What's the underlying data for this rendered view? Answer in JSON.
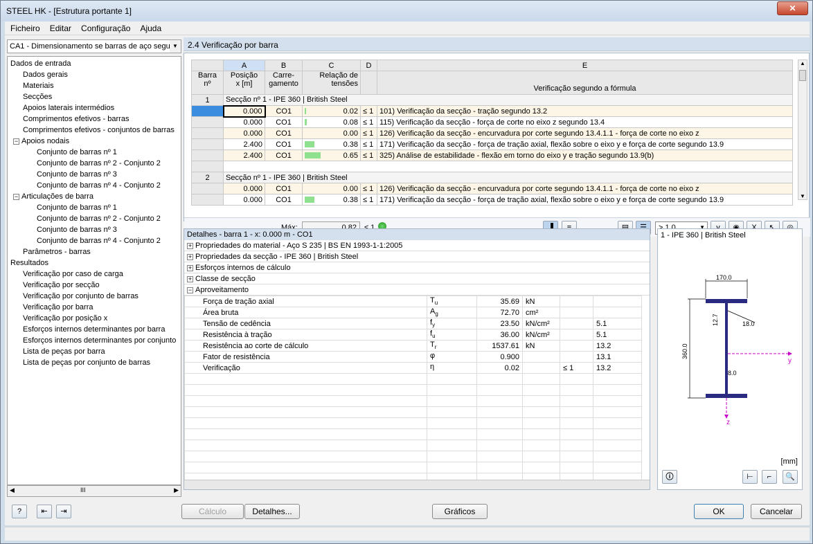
{
  "window": {
    "title": "STEEL HK - [Estrutura portante 1]",
    "close": "✕"
  },
  "menu": [
    "Ficheiro",
    "Editar",
    "Configuração",
    "Ajuda"
  ],
  "case_combo": "CA1 - Dimensionamento se barras de aço segui",
  "tree": {
    "input_root": "Dados de entrada",
    "input_items": [
      "Dados gerais",
      "Materiais",
      "Secções",
      "Apoios laterais intermédios",
      "Comprimentos efetivos - barras",
      "Comprimentos efetivos - conjuntos de barras"
    ],
    "nodal": "Apoios nodais",
    "nodal_items": [
      "Conjunto de barras nº 1",
      "Conjunto de barras nº 2 - Conjunto 2",
      "Conjunto de barras nº 3",
      "Conjunto de barras nº 4 - Conjunto 2"
    ],
    "hinges": "Articulações de barra",
    "hinge_items": [
      "Conjunto de barras nº 1",
      "Conjunto de barras nº 2 - Conjunto 2",
      "Conjunto de barras nº 3",
      "Conjunto de barras nº 4 - Conjunto 2"
    ],
    "params": "Parâmetros - barras",
    "results_root": "Resultados",
    "results_items": [
      "Verificação por caso de carga",
      "Verificação por secção",
      "Verificação por conjunto de barras",
      "Verificação por barra",
      "Verificação por posição x",
      "Esforços internos determinantes por barra",
      "Esforços internos determinantes por conjunto",
      "Lista de peças por barra",
      "Lista de peças por conjunto de barras"
    ],
    "scroll": "III"
  },
  "panel_title": "2.4 Verificação por barra",
  "grid": {
    "cols": [
      "A",
      "B",
      "C",
      "D",
      "E"
    ],
    "h_barra": "Barra",
    "h_no": "nº",
    "h_pos1": "Posição",
    "h_pos2": "x [m]",
    "h_carr1": "Carre-",
    "h_carr2": "gamento",
    "h_rel1": "Relação de",
    "h_rel2": "tensões",
    "h_verif": "Verificação segundo a fórmula",
    "groups": [
      {
        "no": "1",
        "section": "Secção nº 1 - IPE 360 | British Steel",
        "rows": [
          {
            "x": "0.000",
            "lc": "CO1",
            "ratio": "0.02",
            "r": 0.02,
            "le": "≤ 1",
            "desc": "101) Verificação da secção - tração segundo 13.2"
          },
          {
            "x": "0.000",
            "lc": "CO1",
            "ratio": "0.08",
            "r": 0.08,
            "le": "≤ 1",
            "desc": "115) Verificação da secção - força de corte no eixo z segundo 13.4"
          },
          {
            "x": "0.000",
            "lc": "CO1",
            "ratio": "0.00",
            "r": 0.0,
            "le": "≤ 1",
            "desc": "126) Verificação da secção - encurvadura por corte segundo 13.4.1.1 - força de corte no eixo z"
          },
          {
            "x": "2.400",
            "lc": "CO1",
            "ratio": "0.38",
            "r": 0.38,
            "le": "≤ 1",
            "desc": "171) Verificação da secção - força de tração axial, flexão sobre o eixo y e força de corte segundo 13.9"
          },
          {
            "x": "2.400",
            "lc": "CO1",
            "ratio": "0.65",
            "r": 0.65,
            "le": "≤ 1",
            "desc": "325) Análise de estabilidade - flexão em torno do eixo y e tração segundo 13.9(b)"
          }
        ]
      },
      {
        "no": "2",
        "section": "Secção nº 1 - IPE 360 | British Steel",
        "rows": [
          {
            "x": "0.000",
            "lc": "CO1",
            "ratio": "0.00",
            "r": 0.0,
            "le": "≤ 1",
            "desc": "126) Verificação da secção - encurvadura por corte segundo 13.4.1.1 - força de corte no eixo z"
          },
          {
            "x": "0.000",
            "lc": "CO1",
            "ratio": "0.38",
            "r": 0.38,
            "le": "≤ 1",
            "desc": "171) Verificação da secção - força de tração axial, flexão sobre o eixo y e força de corte segundo 13.9"
          }
        ]
      }
    ],
    "max_label": "Máx:",
    "max_value": "0.82",
    "max_le": "≤ 1",
    "filter": "> 1,0"
  },
  "details": {
    "title": "Detalhes - barra 1 - x: 0.000 m - CO1",
    "sections": [
      "Propriedades do material - Aço S 235 | BS EN 1993-1-1:2005",
      "Propriedades da secção  - IPE 360 | British Steel",
      "Esforços internos de cálculo",
      "Classe de secção"
    ],
    "open": "Aproveitamento",
    "rows": [
      {
        "name": "Força de tração axial",
        "sym": "T",
        "sub": "u",
        "val": "35.69",
        "unit": "kN",
        "le": "",
        "ref": ""
      },
      {
        "name": "Área bruta",
        "sym": "A",
        "sub": "g",
        "val": "72.70",
        "unit": "cm²",
        "le": "",
        "ref": ""
      },
      {
        "name": "Tensão de cedência",
        "sym": "f",
        "sub": "y",
        "val": "23.50",
        "unit": "kN/cm²",
        "le": "",
        "ref": "5.1"
      },
      {
        "name": "Resistência à tração",
        "sym": "f",
        "sub": "u",
        "val": "36.00",
        "unit": "kN/cm²",
        "le": "",
        "ref": "5.1"
      },
      {
        "name": "Resistência ao corte de cálculo",
        "sym": "T",
        "sub": "r",
        "val": "1537.61",
        "unit": "kN",
        "le": "",
        "ref": "13.2"
      },
      {
        "name": "Fator de resistência",
        "sym": "φ",
        "sub": "",
        "val": "0.900",
        "unit": "",
        "le": "",
        "ref": "13.1"
      },
      {
        "name": "Verificação",
        "sym": "η",
        "sub": "",
        "val": "0.02",
        "unit": "",
        "le": "≤ 1",
        "ref": "13.2"
      }
    ]
  },
  "section_pic": {
    "title": "1 - IPE 360 | British Steel",
    "b": "170.0",
    "h": "360.0",
    "tf": "12.7",
    "r": "18.0",
    "tw": "8.0",
    "y": "y",
    "z": "z",
    "unit": "[mm]"
  },
  "buttons": {
    "calc": "Cálculo",
    "details": "Detalhes...",
    "graphics": "Gráficos",
    "ok": "OK",
    "cancel": "Cancelar"
  }
}
